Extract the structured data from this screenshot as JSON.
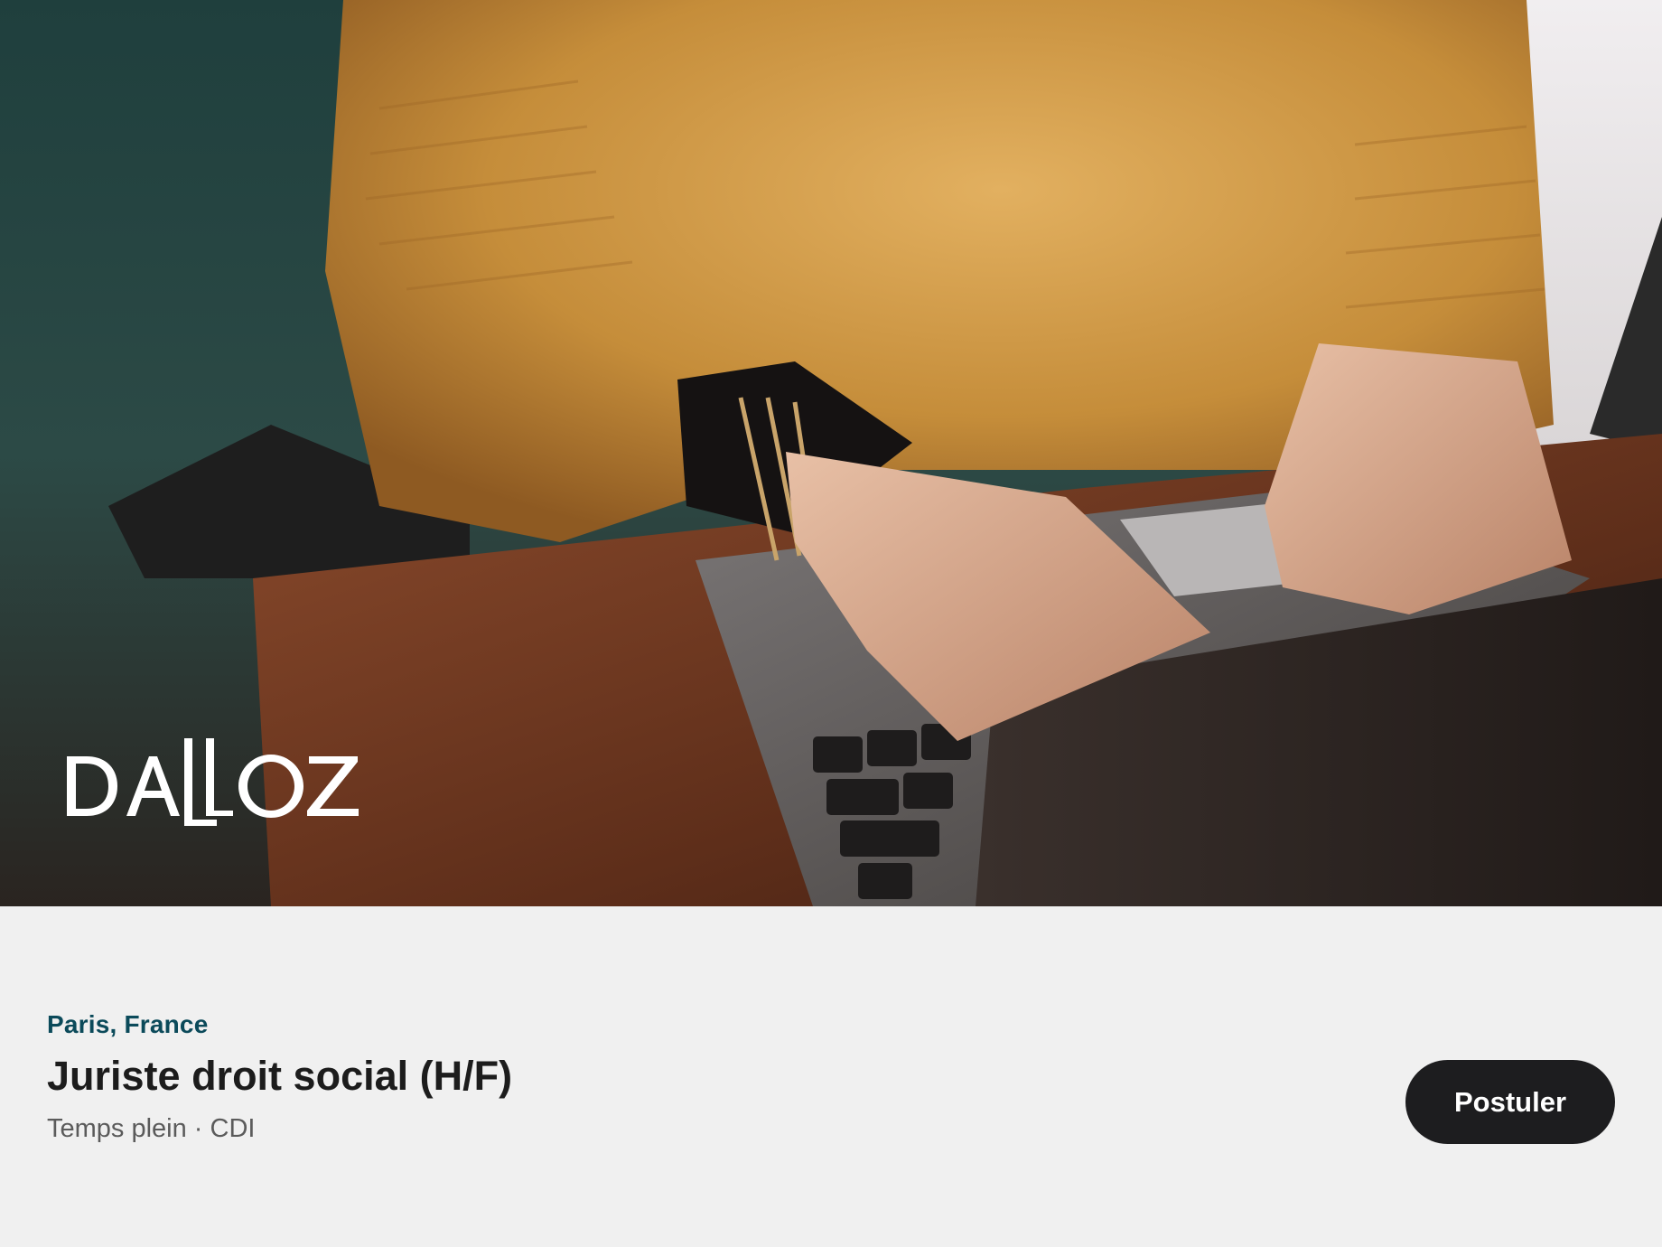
{
  "hero": {
    "logo_text": "DALLOZ",
    "colors": {
      "sweater": "#c18c3c",
      "desk": "#6a3620",
      "laptop": "#4a4644",
      "background": "#2f4a47"
    }
  },
  "job": {
    "location": "Paris, France",
    "title": "Juriste droit social (H/F)",
    "meta": "Temps plein · CDI"
  },
  "actions": {
    "apply_label": "Postuler"
  },
  "colors": {
    "location": "#0b4a5a",
    "button_bg": "#1d1d1f",
    "page_bg": "#f0f0f0"
  }
}
